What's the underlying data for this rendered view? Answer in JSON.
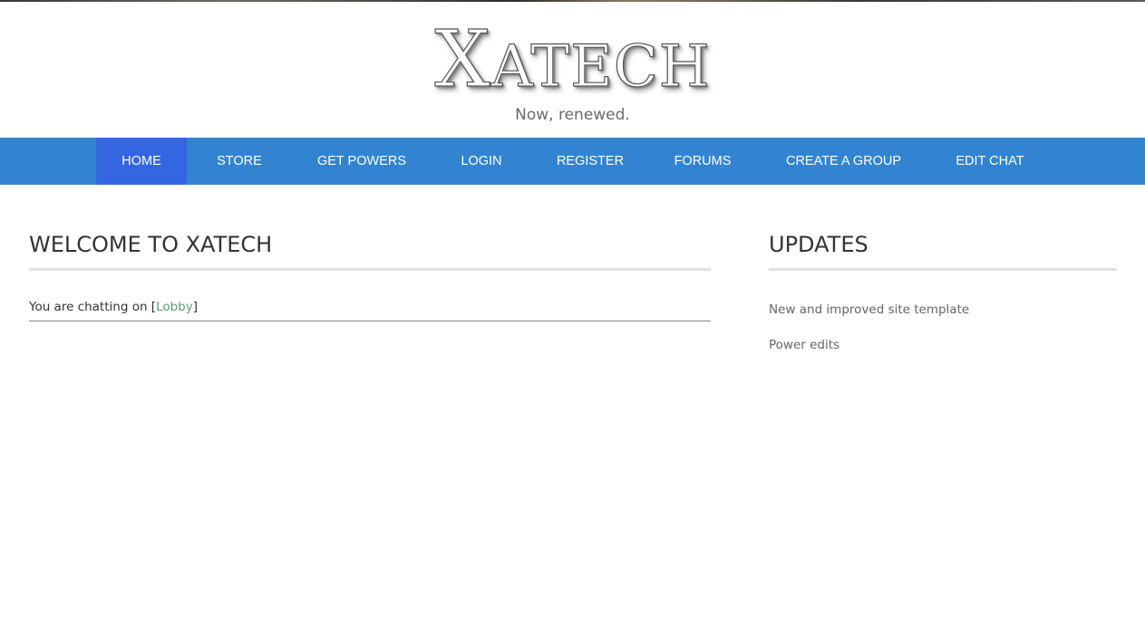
{
  "header": {
    "logo_first": "X",
    "logo_rest": "ATECH",
    "tagline": "Now, renewed."
  },
  "nav": {
    "items": [
      {
        "label": "HOME",
        "active": true
      },
      {
        "label": "STORE"
      },
      {
        "label": "GET POWERS"
      },
      {
        "label": "LOGIN"
      },
      {
        "label": "REGISTER"
      },
      {
        "label": "FORUMS"
      },
      {
        "label": "CREATE A GROUP"
      },
      {
        "label": "EDIT CHAT"
      }
    ]
  },
  "main": {
    "title": "WELCOME TO XATECH",
    "chat_prefix": "You are chatting on [",
    "chat_room": "Lobby",
    "chat_suffix": "]"
  },
  "sidebar": {
    "title": "UPDATES",
    "updates": [
      "New and improved site template",
      "Power edits"
    ]
  },
  "colors": {
    "nav_bg": "#3284d2",
    "nav_active": "#3366e0",
    "link": "#5b9c73"
  }
}
